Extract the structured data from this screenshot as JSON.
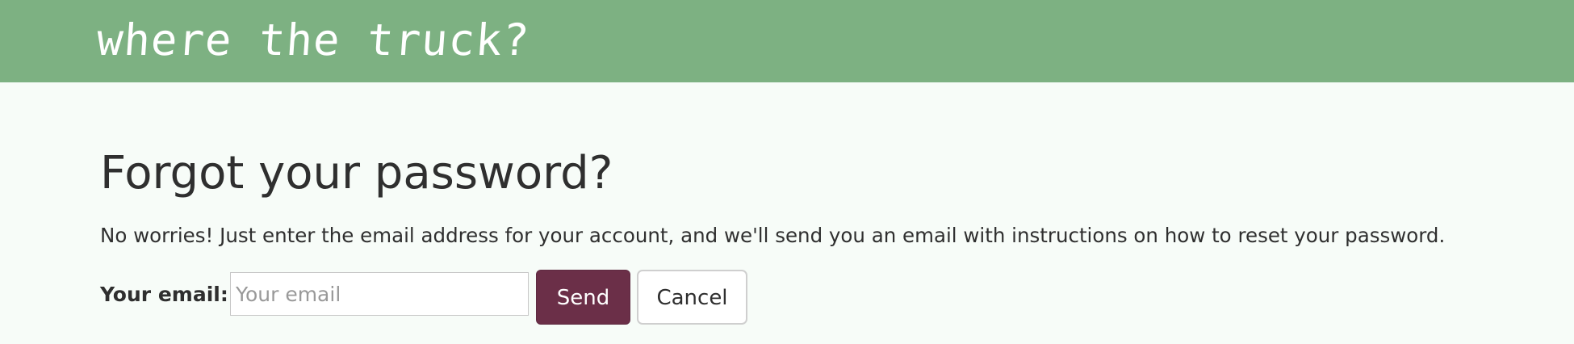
{
  "header": {
    "brand": "where the truck?",
    "background_color": "#7db182"
  },
  "page": {
    "title": "Forgot your password?",
    "description": "No worries! Just enter the email address for your account, and we'll send you an email with instructions on how to reset your password.",
    "background_color": "#f7fcf8"
  },
  "form": {
    "email_label": "Your email:",
    "email_value": "",
    "email_placeholder": "Your email",
    "send_label": "Send",
    "cancel_label": "Cancel",
    "send_button_color": "#6b2f48"
  }
}
